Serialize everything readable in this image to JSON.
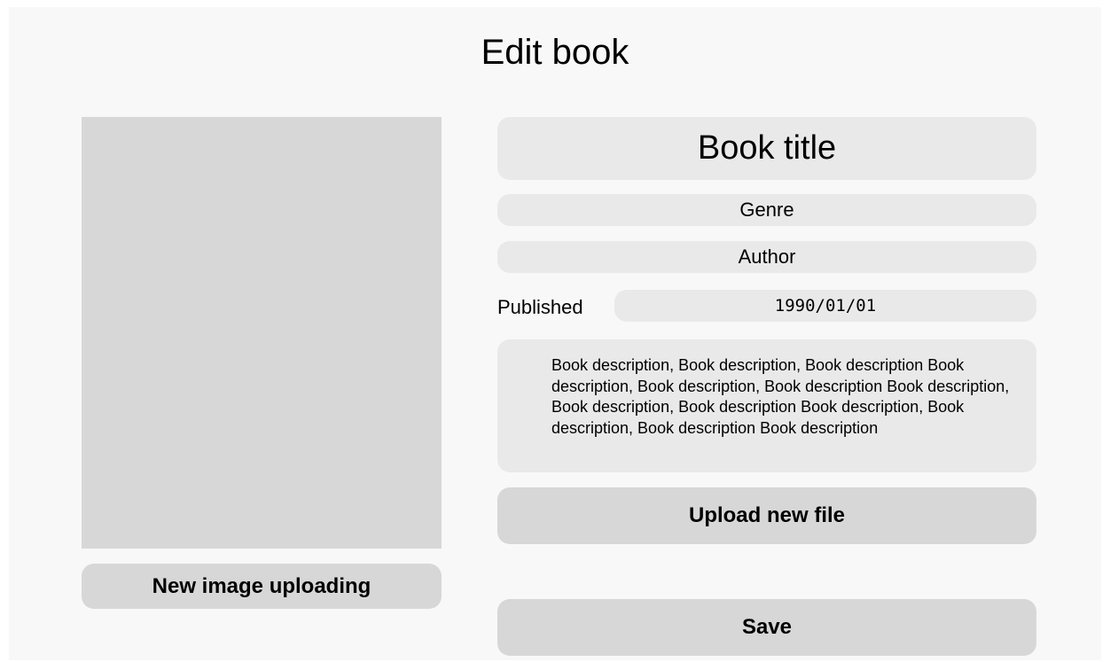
{
  "page": {
    "title": "Edit book"
  },
  "cover": {
    "upload_button_label": "New image uploading"
  },
  "form": {
    "title": "Book title",
    "genre": "Genre",
    "author": "Author",
    "published_label": "Published",
    "published_value": "1990/01/01",
    "description": "Book description, Book description, Book description Book description, Book description, Book description Book description, Book description, Book description Book description, Book description, Book description Book description",
    "upload_file_label": "Upload new file",
    "save_label": "Save"
  },
  "colors": {
    "background": "#f8f8f8",
    "field": "#e9e9e9",
    "button": "#d7d7d7",
    "cover_placeholder": "#d7d7d7"
  }
}
